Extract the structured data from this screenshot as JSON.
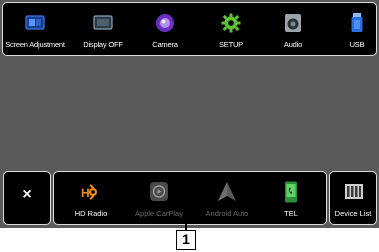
{
  "top_bar": {
    "items": [
      {
        "label": "Screen Adjustment",
        "icon": "screen-adjust-icon"
      },
      {
        "label": "Display OFF",
        "icon": "display-off-icon"
      },
      {
        "label": "Camera",
        "icon": "camera-icon"
      },
      {
        "label": "SETUP",
        "icon": "gear-icon"
      },
      {
        "label": "Audio",
        "icon": "speaker-icon"
      },
      {
        "label": "USB",
        "icon": "usb-icon"
      }
    ]
  },
  "bottom_bar": {
    "close_label": "×",
    "items": [
      {
        "label": "HD Radio",
        "icon": "hd-radio-icon",
        "enabled": true
      },
      {
        "label": "Apple CarPlay",
        "icon": "carplay-icon",
        "enabled": false
      },
      {
        "label": "Android Auto",
        "icon": "android-auto-icon",
        "enabled": false
      },
      {
        "label": "TEL",
        "icon": "phone-icon",
        "enabled": true
      }
    ],
    "device_list_label": "Device List"
  },
  "callout": {
    "number": "1"
  },
  "colors": {
    "accent_blue": "#2a6fe0",
    "accent_purple": "#8a4fd6",
    "accent_green": "#5fbf3a",
    "accent_orange": "#f08a1c",
    "disabled_gray": "#6a6a6a"
  }
}
